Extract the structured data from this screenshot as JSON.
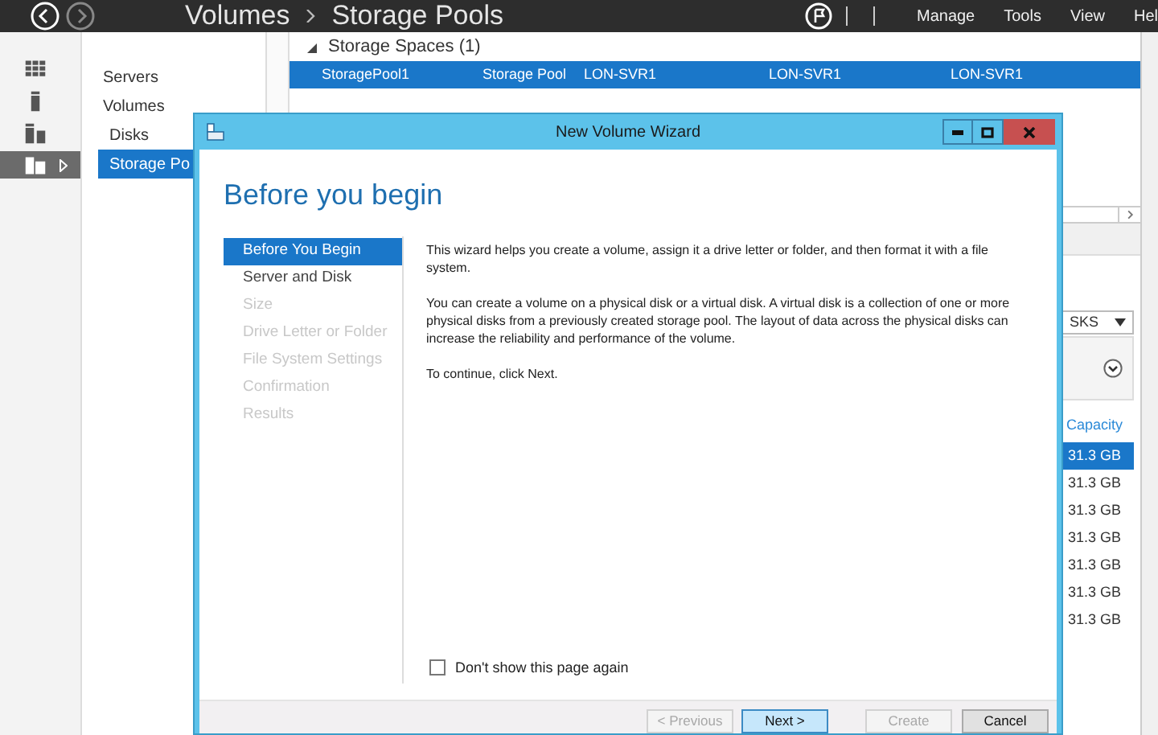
{
  "header": {
    "breadcrumb": [
      "Volumes",
      "Storage Pools"
    ],
    "menu": [
      "Manage",
      "Tools",
      "View",
      "Hel"
    ]
  },
  "sidebar_icons": [
    {
      "selected": false
    },
    {
      "selected": false
    },
    {
      "selected": false
    },
    {
      "selected": true
    }
  ],
  "nav": [
    {
      "label": "Servers",
      "selected": false
    },
    {
      "label": "Volumes",
      "selected": false,
      "children": [
        {
          "label": "Disks",
          "selected": false
        },
        {
          "label": "Storage Po",
          "selected": true
        }
      ]
    }
  ],
  "storage_spaces": {
    "group": "Storage Spaces (1)",
    "expanded": true,
    "rows": [
      {
        "selected": true,
        "cells": [
          "StoragePool1",
          "Storage Pool",
          "LON-SVR1",
          "LON-SVR1",
          "LON-SVR1"
        ]
      }
    ]
  },
  "disks_panel": {
    "dropdown": "SKS",
    "column": "Capacity",
    "rows": [
      {
        "value": "31.3 GB",
        "selected": true
      },
      {
        "value": "31.3 GB",
        "selected": false
      },
      {
        "value": "31.3 GB",
        "selected": false
      },
      {
        "value": "31.3 GB",
        "selected": false
      },
      {
        "value": "31.3 GB",
        "selected": false
      },
      {
        "value": "31.3 GB",
        "selected": false
      },
      {
        "value": "31.3 GB",
        "selected": false
      }
    ]
  },
  "wizard": {
    "title": "New Volume Wizard",
    "heading": "Before you begin",
    "steps": [
      {
        "label": "Before You Begin",
        "selected": true,
        "disabled": false
      },
      {
        "label": "Server and Disk",
        "selected": false,
        "disabled": false
      },
      {
        "label": "Size",
        "selected": false,
        "disabled": true
      },
      {
        "label": "Drive Letter or Folder",
        "selected": false,
        "disabled": true
      },
      {
        "label": "File System Settings",
        "selected": false,
        "disabled": true
      },
      {
        "label": "Confirmation",
        "selected": false,
        "disabled": true
      },
      {
        "label": "Results",
        "selected": false,
        "disabled": true
      }
    ],
    "paragraphs": [
      "This wizard helps you create a volume, assign it a drive letter or folder, and then format it with a file system.",
      "You can create a volume on a physical disk or a virtual disk. A virtual disk is a collection of one or more physical disks from a previously created storage pool. The layout of data across the physical disks can increase the reliability and performance of the volume.",
      "To continue, click Next."
    ],
    "checkbox": {
      "label": "Don't show this page again",
      "checked": false
    },
    "buttons": [
      {
        "label": "< Previous",
        "disabled": true,
        "highlighted": false
      },
      {
        "label": "Next >",
        "disabled": false,
        "highlighted": true
      },
      {
        "label": "Create",
        "disabled": true,
        "highlighted": false
      },
      {
        "label": "Cancel",
        "disabled": false,
        "highlighted": false
      }
    ]
  }
}
